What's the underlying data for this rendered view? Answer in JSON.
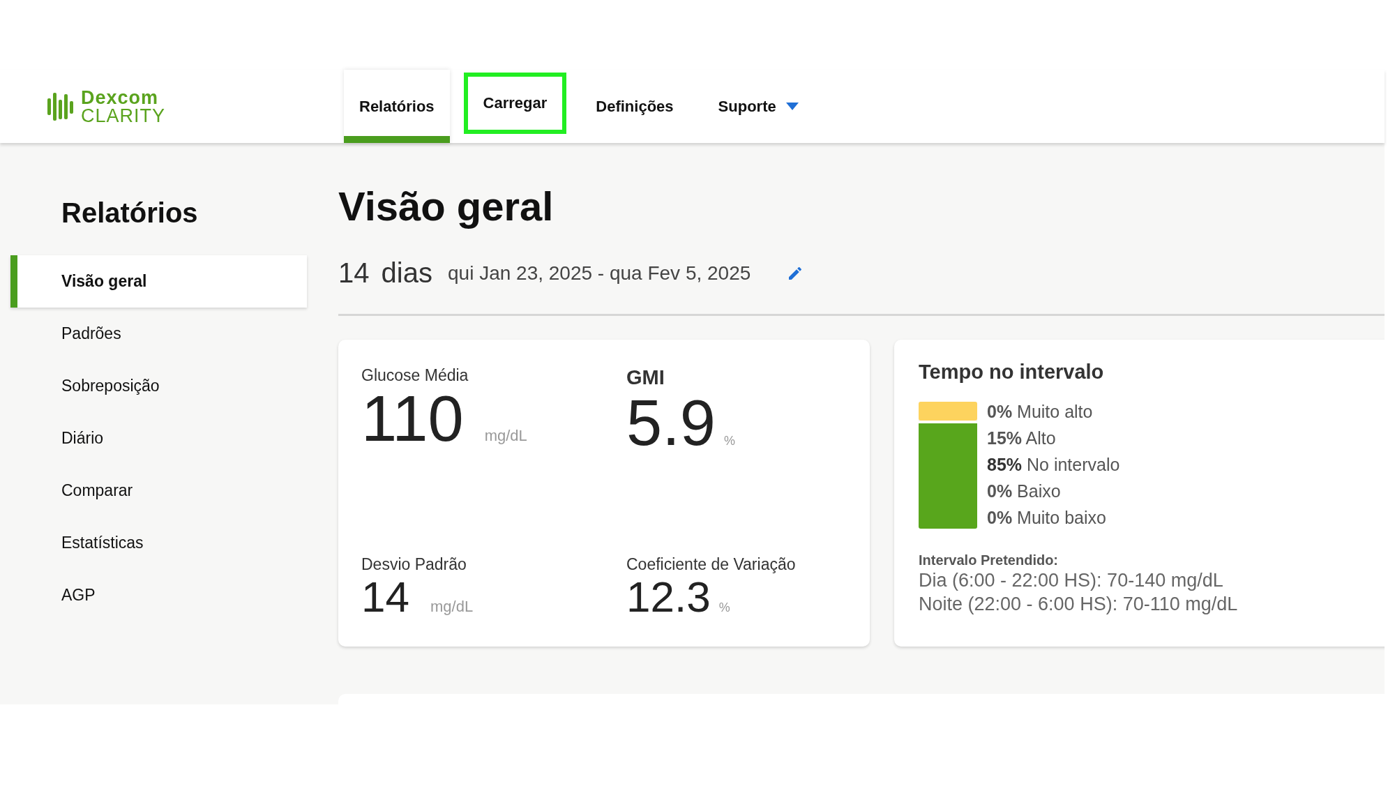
{
  "logo": {
    "brand": "Dexcom",
    "product": "CLARITY"
  },
  "tabs": [
    {
      "label": "Relatórios",
      "selected": true,
      "highlighted": false
    },
    {
      "label": "Carregar",
      "selected": false,
      "highlighted": true
    },
    {
      "label": "Definições",
      "selected": false,
      "highlighted": false
    },
    {
      "label": "Suporte",
      "selected": false,
      "highlighted": false,
      "dropdown": true
    }
  ],
  "sidebar": {
    "title": "Relatórios",
    "items": [
      {
        "label": "Visão geral",
        "selected": true
      },
      {
        "label": "Padrões",
        "selected": false
      },
      {
        "label": "Sobreposição",
        "selected": false
      },
      {
        "label": "Diário",
        "selected": false
      },
      {
        "label": "Comparar",
        "selected": false
      },
      {
        "label": "Estatísticas",
        "selected": false
      },
      {
        "label": "AGP",
        "selected": false
      }
    ]
  },
  "page": {
    "title": "Visão geral",
    "period": "14 dias",
    "dates": "qui Jan 23, 2025 - qua Fev 5, 2025"
  },
  "stats": [
    {
      "label": "Glucose Média",
      "value": "110",
      "unit": "mg/dL",
      "kind": "primary"
    },
    {
      "label": "GMI",
      "value": "5.9",
      "unit": "%",
      "kind": "primary"
    },
    {
      "label": "Desvio Padrão",
      "value": "14",
      "unit": "mg/dL",
      "kind": "secondary"
    },
    {
      "label": "Coeficiente de Variação",
      "value": "12.3",
      "unit": "%",
      "kind": "secondary"
    }
  ],
  "time_in_range": {
    "title": "Tempo no intervalo",
    "bar": [
      {
        "level": 0.15,
        "color": "#fdd35e"
      },
      {
        "level": 0.85,
        "color": "#58a61c"
      }
    ],
    "items": [
      {
        "percent": "0%",
        "label": "Muito alto",
        "emphasis": false
      },
      {
        "percent": "15%",
        "label": "Alto",
        "emphasis": false
      },
      {
        "percent": "85%",
        "label": "No intervalo",
        "emphasis": true
      },
      {
        "percent": "0%",
        "label": "Baixo",
        "emphasis": false
      },
      {
        "percent": "0%",
        "label": "Muito baixo",
        "emphasis": false
      }
    ],
    "target_title": "Intervalo Pretendido:",
    "targets": [
      "Dia (6:00 - 22:00 HS): 70-140 mg/dL",
      "Noite (22:00 - 6:00 HS): 70-110 mg/dL"
    ]
  }
}
